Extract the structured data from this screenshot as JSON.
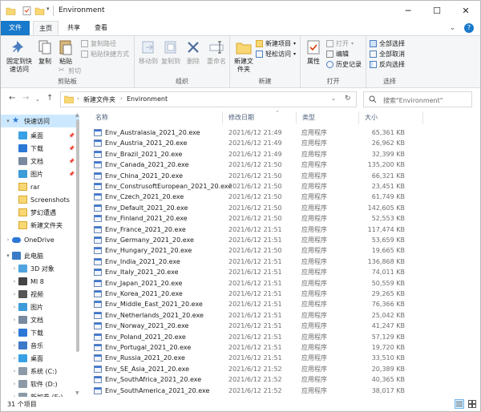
{
  "window": {
    "title": "Environment",
    "min_glyph": "─",
    "max_glyph": "☐",
    "close_glyph": "✕"
  },
  "ribbon_tabs": [
    "文件",
    "主页",
    "共享",
    "查看"
  ],
  "ribbon": {
    "clipboard": {
      "pin": "固定到快速访问",
      "copy": "复制",
      "paste": "粘贴",
      "copy_path": "复制路径",
      "paste_shortcut": "粘贴快捷方式",
      "cut": "剪切",
      "label": "剪贴板"
    },
    "organize": {
      "move_to": "移动到",
      "copy_to": "复制到",
      "delete": "删除",
      "rename": "重命名",
      "label": "组织"
    },
    "new": {
      "new_folder": "新建文件夹",
      "new_item": "新建项目",
      "easy_access": "轻松访问",
      "label": "新建"
    },
    "open": {
      "properties": "属性",
      "open": "打开",
      "edit": "编辑",
      "history": "历史记录",
      "label": "打开"
    },
    "select": {
      "select_all": "全部选择",
      "select_none": "全部取消",
      "invert": "反向选择",
      "label": "选择"
    }
  },
  "address": {
    "path": [
      "新建文件夹",
      "Environment"
    ],
    "search_placeholder": "搜索\"Environment\""
  },
  "nav_pane": [
    {
      "label": "快速访问",
      "icon": "star-icon",
      "level": 0,
      "selected": true,
      "chevron": "▾"
    },
    {
      "label": "桌面",
      "icon": "desktop-icon",
      "level": 1,
      "pin": true
    },
    {
      "label": "下载",
      "icon": "download-icon",
      "level": 1,
      "pin": true
    },
    {
      "label": "文档",
      "icon": "document-icon",
      "level": 1,
      "pin": true
    },
    {
      "label": "图片",
      "icon": "pictures-icon",
      "level": 1,
      "pin": true
    },
    {
      "label": "rar",
      "icon": "folder-icon",
      "level": 1
    },
    {
      "label": "Screenshots",
      "icon": "folder-icon",
      "level": 1
    },
    {
      "label": "梦幻遭遇",
      "icon": "folder-icon",
      "level": 1
    },
    {
      "label": "新建文件夹",
      "icon": "folder-icon",
      "level": 1
    },
    {
      "label": "OneDrive",
      "icon": "cloud-icon",
      "level": 0,
      "chevron": "›"
    },
    {
      "label": "此电脑",
      "icon": "computer-icon",
      "level": 0,
      "chevron": "▾"
    },
    {
      "label": "3D 对象",
      "icon": "cube-icon",
      "level": 1,
      "chevron": "›"
    },
    {
      "label": "MI 8",
      "icon": "phone-icon",
      "level": 1,
      "chevron": "›"
    },
    {
      "label": "视频",
      "icon": "video-icon",
      "level": 1,
      "chevron": "›"
    },
    {
      "label": "图片",
      "icon": "pictures-icon",
      "level": 1,
      "chevron": "›"
    },
    {
      "label": "文档",
      "icon": "document-icon",
      "level": 1,
      "chevron": "›"
    },
    {
      "label": "下载",
      "icon": "download-icon",
      "level": 1,
      "chevron": "›"
    },
    {
      "label": "音乐",
      "icon": "music-icon",
      "level": 1,
      "chevron": "›"
    },
    {
      "label": "桌面",
      "icon": "desktop-icon",
      "level": 1,
      "chevron": "›"
    },
    {
      "label": "系统 (C:)",
      "icon": "drive-icon",
      "level": 1,
      "chevron": "›"
    },
    {
      "label": "软件 (D:)",
      "icon": "drive-icon",
      "level": 1,
      "chevron": "›"
    },
    {
      "label": "新加卷 (E:)",
      "icon": "drive-icon",
      "level": 1,
      "chevron": "›"
    }
  ],
  "columns": {
    "name": "名称",
    "date": "修改日期",
    "type": "类型",
    "size": "大小"
  },
  "files": [
    {
      "name": "Env_Australasia_2021_20.exe",
      "date": "2021/6/12 21:49",
      "type": "应用程序",
      "size": "65,361 KB"
    },
    {
      "name": "Env_Austria_2021_20.exe",
      "date": "2021/6/12 21:49",
      "type": "应用程序",
      "size": "26,962 KB"
    },
    {
      "name": "Env_Brazil_2021_20.exe",
      "date": "2021/6/12 21:49",
      "type": "应用程序",
      "size": "32,399 KB"
    },
    {
      "name": "Env_Canada_2021_20.exe",
      "date": "2021/6/12 21:50",
      "type": "应用程序",
      "size": "135,200 KB"
    },
    {
      "name": "Env_China_2021_20.exe",
      "date": "2021/6/12 21:50",
      "type": "应用程序",
      "size": "66,321 KB"
    },
    {
      "name": "Env_ConstrusoftEuropean_2021_20.exe",
      "date": "2021/6/12 21:50",
      "type": "应用程序",
      "size": "23,451 KB"
    },
    {
      "name": "Env_Czech_2021_20.exe",
      "date": "2021/6/12 21:50",
      "type": "应用程序",
      "size": "61,749 KB"
    },
    {
      "name": "Env_Default_2021_20.exe",
      "date": "2021/6/12 21:50",
      "type": "应用程序",
      "size": "142,605 KB"
    },
    {
      "name": "Env_Finland_2021_20.exe",
      "date": "2021/6/12 21:50",
      "type": "应用程序",
      "size": "52,553 KB"
    },
    {
      "name": "Env_France_2021_20.exe",
      "date": "2021/6/12 21:51",
      "type": "应用程序",
      "size": "117,474 KB"
    },
    {
      "name": "Env_Germany_2021_20.exe",
      "date": "2021/6/12 21:51",
      "type": "应用程序",
      "size": "53,659 KB"
    },
    {
      "name": "Env_Hungary_2021_20.exe",
      "date": "2021/6/12 21:50",
      "type": "应用程序",
      "size": "19,665 KB"
    },
    {
      "name": "Env_India_2021_20.exe",
      "date": "2021/6/12 21:51",
      "type": "应用程序",
      "size": "136,868 KB"
    },
    {
      "name": "Env_Italy_2021_20.exe",
      "date": "2021/6/12 21:51",
      "type": "应用程序",
      "size": "74,011 KB"
    },
    {
      "name": "Env_Japan_2021_20.exe",
      "date": "2021/6/12 21:51",
      "type": "应用程序",
      "size": "50,559 KB"
    },
    {
      "name": "Env_Korea_2021_20.exe",
      "date": "2021/6/12 21:51",
      "type": "应用程序",
      "size": "29,265 KB"
    },
    {
      "name": "Env_Middle_East_2021_20.exe",
      "date": "2021/6/12 21:51",
      "type": "应用程序",
      "size": "76,366 KB"
    },
    {
      "name": "Env_Netherlands_2021_20.exe",
      "date": "2021/6/12 21:51",
      "type": "应用程序",
      "size": "25,042 KB"
    },
    {
      "name": "Env_Norway_2021_20.exe",
      "date": "2021/6/12 21:51",
      "type": "应用程序",
      "size": "41,247 KB"
    },
    {
      "name": "Env_Poland_2021_20.exe",
      "date": "2021/6/12 21:51",
      "type": "应用程序",
      "size": "57,129 KB"
    },
    {
      "name": "Env_Portugal_2021_20.exe",
      "date": "2021/6/12 21:51",
      "type": "应用程序",
      "size": "19,720 KB"
    },
    {
      "name": "Env_Russia_2021_20.exe",
      "date": "2021/6/12 21:51",
      "type": "应用程序",
      "size": "33,510 KB"
    },
    {
      "name": "Env_SE_Asia_2021_20.exe",
      "date": "2021/6/12 21:52",
      "type": "应用程序",
      "size": "20,389 KB"
    },
    {
      "name": "Env_SouthAfrica_2021_20.exe",
      "date": "2021/6/12 21:52",
      "type": "应用程序",
      "size": "40,365 KB"
    },
    {
      "name": "Env_SouthAmerica_2021_20.exe",
      "date": "2021/6/12 21:52",
      "type": "应用程序",
      "size": "38,017 KB"
    }
  ],
  "status": {
    "item_count": "31 个项目"
  },
  "colors": {
    "accent": "#1979ca",
    "selection": "#cce8ff",
    "folder": "#f8d775",
    "header_text": "#4c607a"
  }
}
